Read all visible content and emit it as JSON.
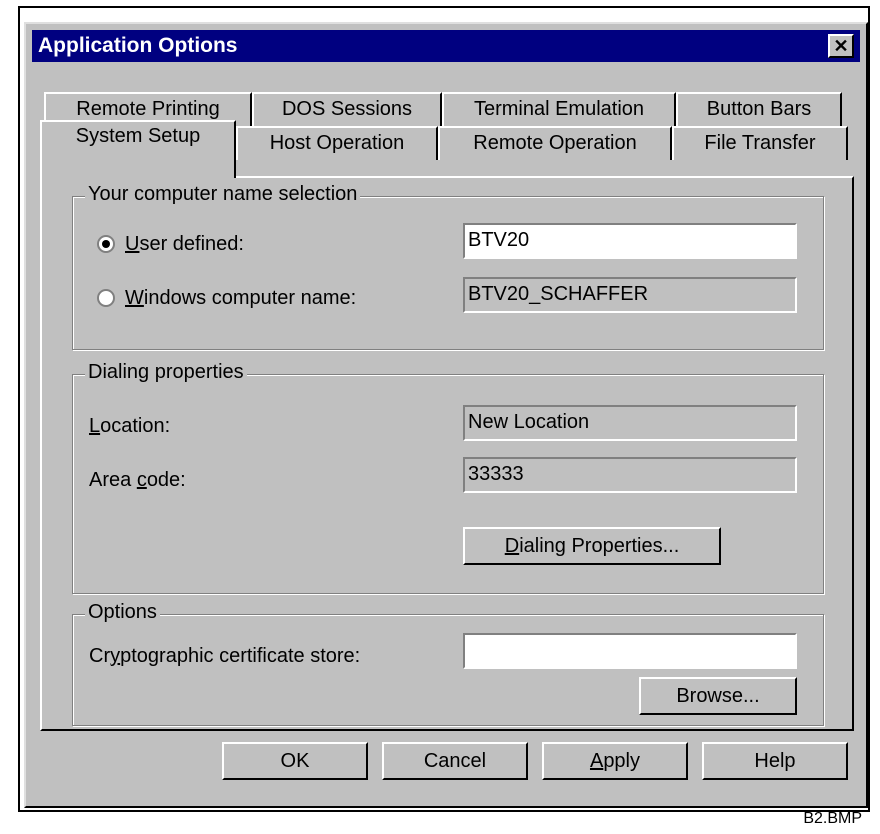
{
  "window": {
    "title": "Application Options"
  },
  "tabs_row1": [
    "Remote Printing",
    "DOS Sessions",
    "Terminal Emulation",
    "Button Bars"
  ],
  "tabs_row2": [
    "System Setup",
    "Host Operation",
    "Remote Operation",
    "File Transfer"
  ],
  "computer_name": {
    "group_title": "Your computer name selection",
    "user_defined_label": "User defined:",
    "user_defined_value": "BTV20",
    "windows_name_label": "Windows computer name:",
    "windows_name_value": "BTV20_SCHAFFER",
    "selected": "user_defined"
  },
  "dialing": {
    "group_title": "Dialing properties",
    "location_label": "Location:",
    "location_value": "New Location",
    "area_code_label": "Area code:",
    "area_code_value": "33333",
    "properties_button": "Dialing Properties..."
  },
  "options": {
    "group_title": "Options",
    "cert_store_label": "Cryptographic certificate store:",
    "cert_store_value": "",
    "browse_button": "Browse..."
  },
  "buttons": {
    "ok": "OK",
    "cancel": "Cancel",
    "apply": "Apply",
    "help": "Help"
  },
  "caption": "B2.BMP"
}
